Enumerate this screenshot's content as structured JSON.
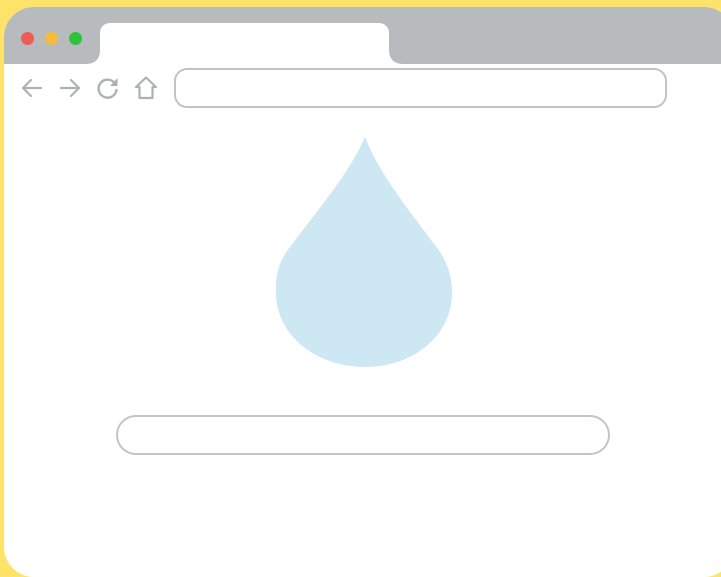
{
  "window": {
    "controls": [
      {
        "name": "close",
        "color": "#ef5b55"
      },
      {
        "name": "minimize",
        "color": "#f5bb3a"
      },
      {
        "name": "zoom",
        "color": "#2fc33d"
      }
    ],
    "tab": {
      "title": ""
    }
  },
  "toolbar": {
    "icons": [
      "back-arrow-icon",
      "forward-arrow-icon",
      "reload-icon",
      "home-icon"
    ],
    "icon_color": "#aeb1b4",
    "address": {
      "value": ""
    }
  },
  "content": {
    "drop_icon": "water-drop-icon",
    "drop_color": "#cde8f3",
    "input": {
      "value": ""
    }
  },
  "colors": {
    "background": "#fde36a",
    "titlebar": "#b7bbbe",
    "border": "#c4c4c4"
  }
}
